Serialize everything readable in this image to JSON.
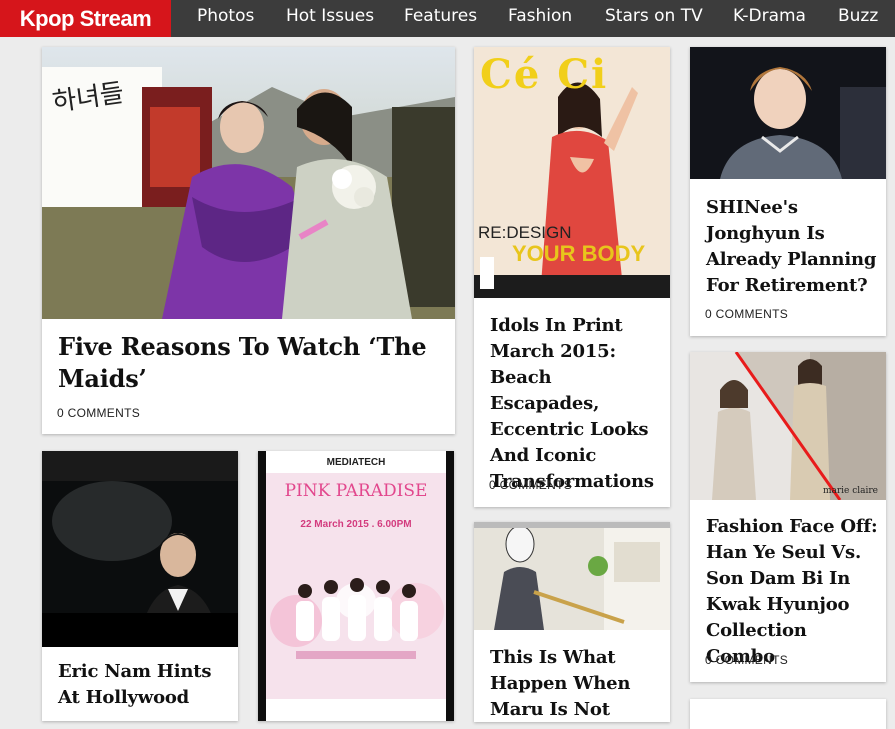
{
  "site": {
    "logo": "Kpop Stream"
  },
  "nav": [
    {
      "label": "Photos"
    },
    {
      "label": "Hot Issues"
    },
    {
      "label": "Features"
    },
    {
      "label": "Fashion"
    },
    {
      "label": "Stars on TV"
    },
    {
      "label": "K-Drama"
    },
    {
      "label": "Buzz"
    }
  ],
  "articles": [
    {
      "title": "Five Reasons To Watch ‘The Maids’",
      "comments": "0 COMMENTS",
      "image": "drama-couple-photo"
    },
    {
      "title": "Idols In Print March 2015: Beach Escapades, Eccentric Looks And Iconic Transformations",
      "comments": "0 COMMENTS",
      "image": "magazine-cover-photo"
    },
    {
      "title": "SHINee's Jonghyun Is Already Planning For Retirement?",
      "comments": "0 COMMENTS",
      "image": "jonghyun-photo"
    },
    {
      "title": "Fashion Face Off: Han Ye Seul Vs. Son Dam Bi In Kwak Hyunjoo Collection Combo",
      "comments": "0 COMMENTS",
      "image": "fashion-faceoff-photo"
    },
    {
      "title": "Eric Nam Hints At Hollywood",
      "image": "eric-nam-photo"
    },
    {
      "title": "",
      "image": "pink-paradise-poster"
    },
    {
      "title": "This Is What Happen When Maru Is Not",
      "image": "meme-photo"
    }
  ],
  "images": {
    "maids_calligraphy": "하녀들",
    "magazine_logo": "Cé Ci",
    "magazine_redesign": "RE:DESIGN",
    "magazine_body": "YOUR BODY",
    "poster_sponsor": "MEDIATECH",
    "poster_title": "PINK PARADISE",
    "poster_date": "22 March 2015 . 6.00PM",
    "marie_claire": "marie claire"
  }
}
